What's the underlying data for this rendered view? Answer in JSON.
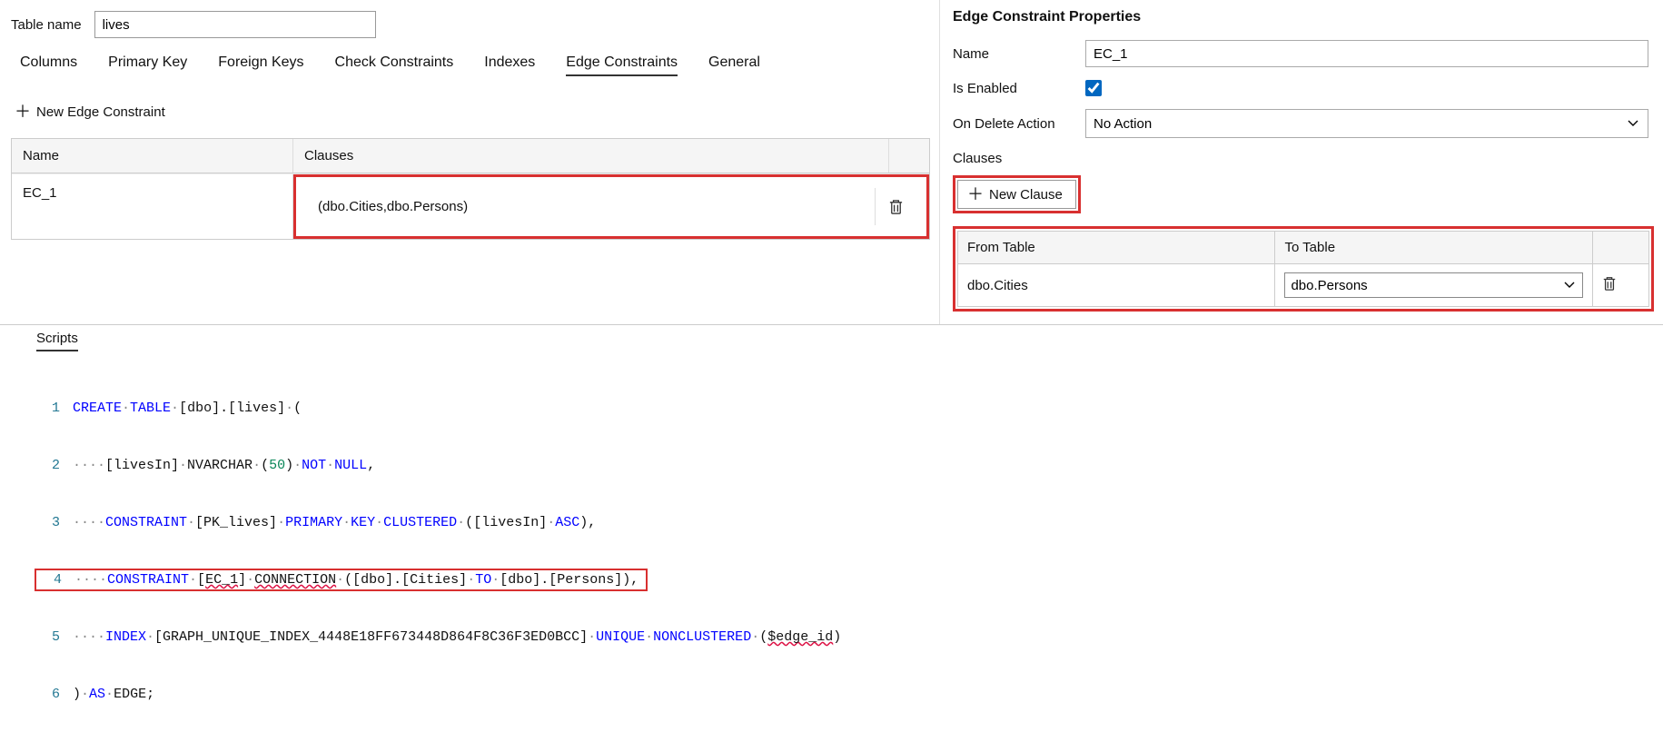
{
  "table_name_label": "Table name",
  "table_name_value": "lives",
  "tabs": {
    "columns": "Columns",
    "primary_key": "Primary Key",
    "foreign_keys": "Foreign Keys",
    "check_constraints": "Check Constraints",
    "indexes": "Indexes",
    "edge_constraints": "Edge Constraints",
    "general": "General"
  },
  "new_edge_constraint": "New Edge Constraint",
  "grid": {
    "header_name": "Name",
    "header_clauses": "Clauses",
    "rows": [
      {
        "name": "EC_1",
        "clauses": "(dbo.Cities,dbo.Persons)"
      }
    ]
  },
  "props": {
    "title": "Edge Constraint Properties",
    "name_label": "Name",
    "name_value": "EC_1",
    "is_enabled_label": "Is Enabled",
    "is_enabled": true,
    "on_delete_label": "On Delete Action",
    "on_delete_value": "No Action",
    "clauses_label": "Clauses",
    "new_clause": "New Clause",
    "clause_header_from": "From Table",
    "clause_header_to": "To Table",
    "clause_rows": [
      {
        "from": "dbo.Cities",
        "to": "dbo.Persons"
      }
    ]
  },
  "scripts": {
    "title": "Scripts",
    "lines": [
      "CREATE TABLE [dbo].[lives] (",
      "    [livesIn] NVARCHAR (50) NOT NULL,",
      "    CONSTRAINT [PK_lives] PRIMARY KEY CLUSTERED ([livesIn] ASC),",
      "    CONSTRAINT [EC_1] CONNECTION ([dbo].[Cities] TO [dbo].[Persons]),",
      "    INDEX [GRAPH_UNIQUE_INDEX_4448E18FF673448D864F8C36F3ED0BCC] UNIQUE NONCLUSTERED ($edge_id)",
      ") AS EDGE;"
    ]
  }
}
